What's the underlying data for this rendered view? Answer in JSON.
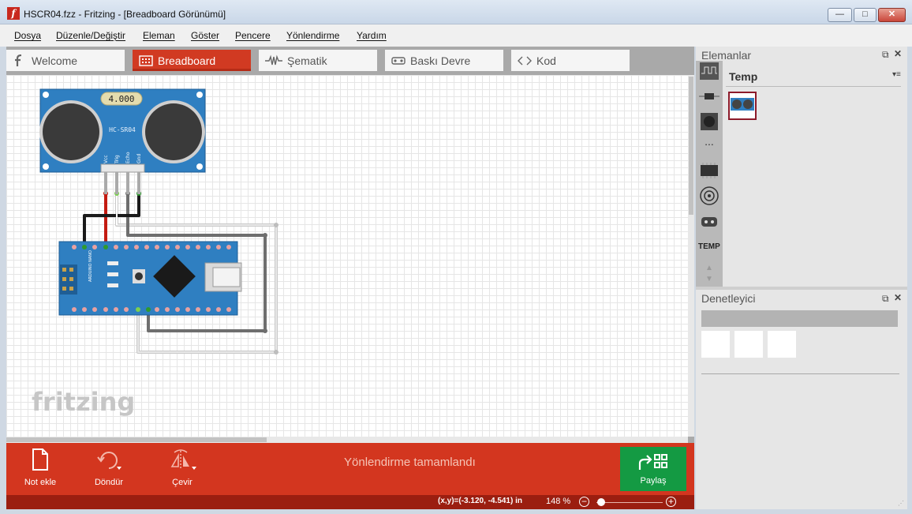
{
  "window": {
    "title": "HSCR04.fzz - Fritzing - [Breadboard Görünümü]",
    "minimize": "—",
    "maximize": "□",
    "close": "✕"
  },
  "menu": [
    "Dosya",
    "Düzenle/Değiştir",
    "Eleman",
    "Göster",
    "Pencere",
    "Yönlendirme",
    "Yardım"
  ],
  "tabs": [
    {
      "label": "Welcome",
      "icon": "fritzing-f-icon"
    },
    {
      "label": "Breadboard",
      "icon": "breadboard-icon",
      "active": true
    },
    {
      "label": "Şematik",
      "icon": "resistor-icon"
    },
    {
      "label": "Baskı Devre",
      "icon": "pcb-icon"
    },
    {
      "label": "Kod",
      "icon": "code-icon"
    }
  ],
  "canvas": {
    "logo": "fritzing",
    "sensor": {
      "display": "4.000",
      "model": "HC-SR04",
      "pins": [
        "Vcc",
        "Trig",
        "Echo",
        "Gnd"
      ]
    },
    "arduino": {
      "label": "ARDUINO NANO",
      "chip_color": "#1a1a1a"
    }
  },
  "toolbar": {
    "note": "Not ekle",
    "rotate": "Döndür",
    "flip": "Çevir",
    "message": "Yönlendirme tamamlandı",
    "share": "Paylaş"
  },
  "status": {
    "coords": "(x,y)=(-3.120, -4.541) in",
    "zoom": "148 %",
    "zoom_minus": "−",
    "zoom_plus": "+"
  },
  "parts_panel": {
    "title": "Elemanlar",
    "bin_title": "Temp",
    "bin_short": "TEMP",
    "more": "..."
  },
  "inspector": {
    "title": "Denetleyici"
  },
  "colors": {
    "accent": "#d3361f",
    "share": "#149a43",
    "board": "#2f7fc1"
  }
}
